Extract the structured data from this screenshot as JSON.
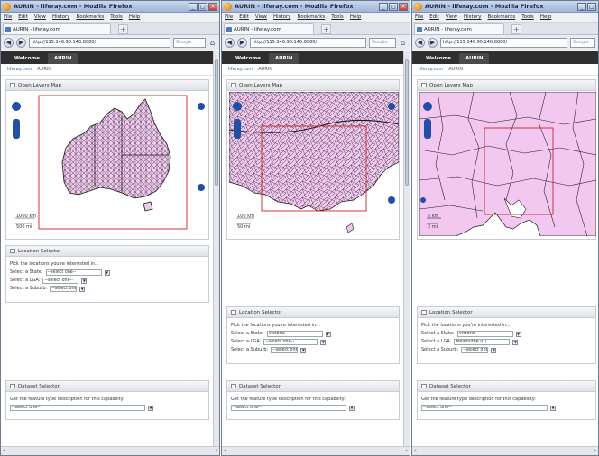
{
  "windows": [
    {
      "title": "AURIN - liferay.com - Mozilla Firefox",
      "menus": [
        "File",
        "Edit",
        "View",
        "History",
        "Bookmarks",
        "Tools",
        "Help"
      ],
      "tab_label": "AURIN - liferay.com",
      "url": "http://115.146.90.140:8080/",
      "search_placeholder": "Google",
      "dock": [
        "Welcome",
        "AURIN"
      ],
      "breadcrumbs": [
        "liferay.com",
        "AURIN"
      ],
      "map_portlet": {
        "title": "Open Layers Map",
        "scale": [
          "1000 km",
          "500 mi"
        ]
      },
      "location_selector": {
        "title": "Location Selector",
        "prompt": "Pick the locations you're interested in...",
        "state_label": "Select a State:",
        "state_value": "--select one--",
        "lga_label": "Select a LGA:",
        "lga_value": "--select one--",
        "suburb_label": "Select a Suburb:",
        "suburb_value": "--select one--"
      },
      "dataset_selector": {
        "title": "Dataset Selector",
        "prompt": "Get the feature type description for this capability:",
        "value": "--select one--"
      }
    },
    {
      "title": "AURIN - liferay.com - Mozilla Firefox",
      "menus": [
        "File",
        "Edit",
        "View",
        "History",
        "Bookmarks",
        "Tools",
        "Help"
      ],
      "tab_label": "AURIN - liferay.com",
      "url": "http://115.146.90.140:8080/",
      "search_placeholder": "Google",
      "dock": [
        "Welcome",
        "AURIN"
      ],
      "breadcrumbs": [
        "liferay.com",
        "AURIN"
      ],
      "map_portlet": {
        "title": "Open Layers Map",
        "scale": [
          "100 km",
          "50 mi"
        ]
      },
      "location_selector": {
        "title": "Location Selector",
        "prompt": "Pick the locations you're interested in...",
        "state_label": "Select a State:",
        "state_value": "Victoria",
        "lga_label": "Select a LGA:",
        "lga_value": "--select one--",
        "suburb_label": "Select a Suburb:",
        "suburb_value": "--select one--"
      },
      "dataset_selector": {
        "title": "Dataset Selector",
        "prompt": "Get the feature type description for this capability:",
        "value": "--select one--"
      }
    },
    {
      "title": "AURIN - liferay.com - Mozilla Firefox",
      "menus": [
        "File",
        "Edit",
        "View",
        "History",
        "Bookmarks",
        "Tools",
        "Help"
      ],
      "tab_label": "AURIN - liferay.com",
      "url": "http://115.146.90.140:8080/",
      "search_placeholder": "Google",
      "dock": [
        "Welcome",
        "AURIN"
      ],
      "breadcrumbs": [
        "liferay.com",
        "AURIN"
      ],
      "map_portlet": {
        "title": "Open Layers Map",
        "scale": [
          "5 km",
          "2 mi"
        ]
      },
      "location_selector": {
        "title": "Location Selector",
        "prompt": "Pick the locations you're interested in...",
        "state_label": "Select a State:",
        "state_value": "Victoria",
        "lga_label": "Select a LGA:",
        "lga_value": "Melbourne (C)",
        "suburb_label": "Select a Suburb:",
        "suburb_value": "--select one--"
      },
      "dataset_selector": {
        "title": "Dataset Selector",
        "prompt": "Get the feature type description for this capability:",
        "value": "--select one--"
      }
    }
  ],
  "colors": {
    "map_fill": "#f2c8f0",
    "map_stroke": "#1a1a1a",
    "extent_box": "#d22222",
    "pan_control": "#1f4fa8",
    "dock_bg": "#2f2f2f"
  }
}
